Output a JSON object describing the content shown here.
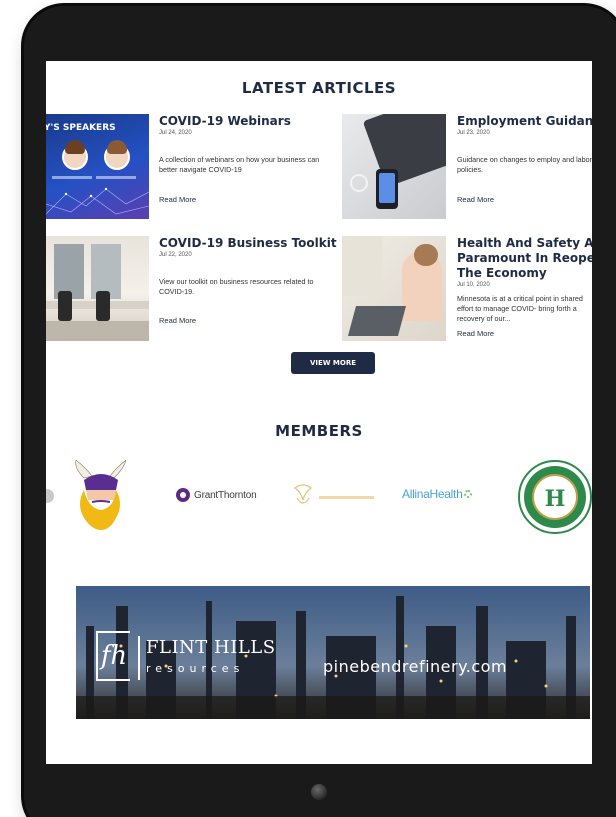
{
  "latest_articles": {
    "heading": "LATEST ARTICLES",
    "articles": [
      {
        "title": "COVID-19 Webinars",
        "date": "Jul 24, 2020",
        "description": "A collection of webinars on how your business can better navigate COVID-19",
        "read_more": "Read More",
        "image_text": "Y'S SPEAKERS"
      },
      {
        "title": "Employment Guidance",
        "date": "Jul 23, 2020",
        "description": "Guidance on changes to employ and labor policies.",
        "read_more": "Read More"
      },
      {
        "title": "COVID-19 Business Toolkit",
        "date": "Jul 22, 2020",
        "description": "View our toolkit on business resources related to COVID-19.",
        "read_more": "Read More"
      },
      {
        "title_lines": [
          "Health And Safety Are",
          "Paramount In Reopenin",
          "The Economy"
        ],
        "date": "Jul 10, 2020",
        "description": "Minnesota is at a critical point in shared effort to manage COVID- bring forth a recovery of our...",
        "read_more": "Read More"
      }
    ],
    "view_more": "VIEW MORE"
  },
  "members": {
    "heading": "MEMBERS",
    "logos": [
      {
        "name": "GrantThornton",
        "icon": "grant-thornton-logo"
      },
      {
        "name": "AllinaHealth",
        "icon": "allina-health-logo"
      }
    ]
  },
  "banner": {
    "brand_main": "FLINT HILLS",
    "brand_sub": "resources",
    "url": "pinebendrefinery.com"
  },
  "colors": {
    "navy": "#1f2a44",
    "frame": "#1a1a1a",
    "allina": "#4aa3d8"
  }
}
